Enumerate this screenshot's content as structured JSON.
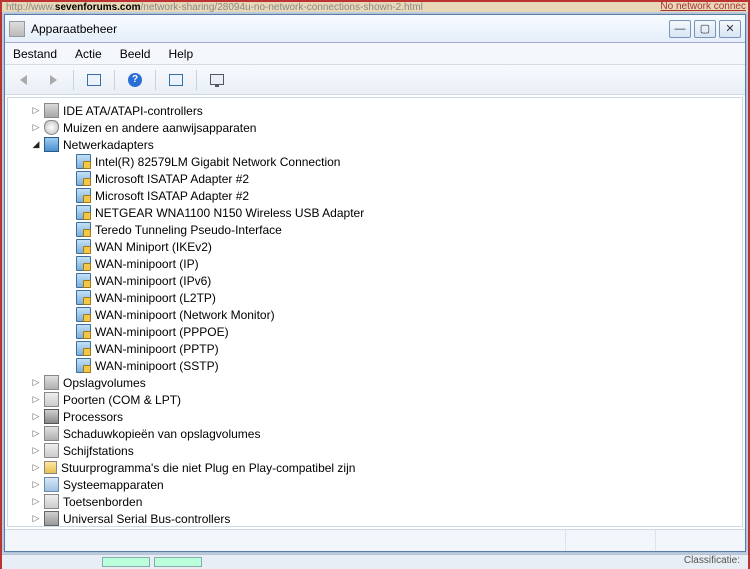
{
  "browser": {
    "url_pre": "http://www.",
    "url_domain": "sevenforums.com",
    "url_rest": "/network-sharing/28094u-no-network-connections-shown-2.html",
    "right_link": "No network connec"
  },
  "window": {
    "title": "Apparaatbeheer"
  },
  "menu": {
    "bestand": "Bestand",
    "actie": "Actie",
    "beeld": "Beeld",
    "help": "Help"
  },
  "tree": {
    "ide": "IDE ATA/ATAPI-controllers",
    "mice": "Muizen en andere aanwijsapparaten",
    "net": "Netwerkadapters",
    "net_items": [
      "Intel(R) 82579LM Gigabit Network Connection",
      "Microsoft ISATAP Adapter #2",
      "Microsoft ISATAP Adapter #2",
      "NETGEAR WNA1100 N150 Wireless USB Adapter",
      "Teredo Tunneling Pseudo-Interface",
      "WAN Miniport (IKEv2)",
      "WAN-minipoort (IP)",
      "WAN-minipoort (IPv6)",
      "WAN-minipoort (L2TP)",
      "WAN-minipoort (Network Monitor)",
      "WAN-minipoort (PPPOE)",
      "WAN-minipoort (PPTP)",
      "WAN-minipoort (SSTP)"
    ],
    "storage": "Opslagvolumes",
    "ports": "Poorten (COM & LPT)",
    "proc": "Processors",
    "shadow": "Schaduwkopieën van opslagvolumes",
    "disk": "Schijfstations",
    "driver": "Stuurprogramma's die niet Plug en Play-compatibel zijn",
    "system": "Systeemapparaten",
    "keyboard": "Toetsenborden",
    "usb": "Universal Serial Bus-controllers"
  },
  "bottom": {
    "class": "Classificatie:"
  }
}
